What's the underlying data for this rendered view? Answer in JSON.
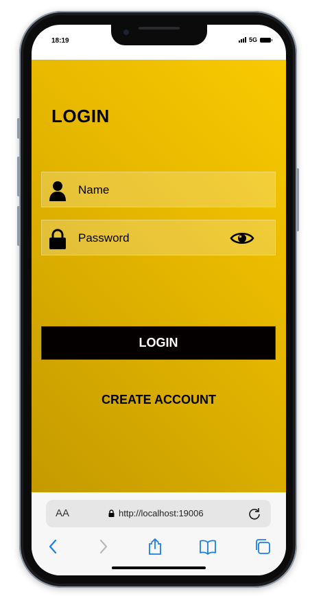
{
  "status_bar": {
    "time": "18:19",
    "network": "5G"
  },
  "screen": {
    "title": "LOGIN",
    "name_field": {
      "placeholder": "Name",
      "icon": "user-icon"
    },
    "password_field": {
      "placeholder": "Password",
      "icon": "lock-icon",
      "toggle_icon": "eye-icon"
    },
    "login_button": "LOGIN",
    "create_account_link": "CREATE ACCOUNT"
  },
  "browser": {
    "text_size_label": "AA",
    "url": "http://localhost:19006",
    "toolbar_icons": [
      "back-icon",
      "forward-icon",
      "share-icon",
      "bookmarks-icon",
      "tabs-icon"
    ]
  },
  "colors": {
    "accent": "#f9c901",
    "accent_dark": "#c49a00",
    "button": "#050000",
    "ios_blue": "#1a7de8"
  }
}
